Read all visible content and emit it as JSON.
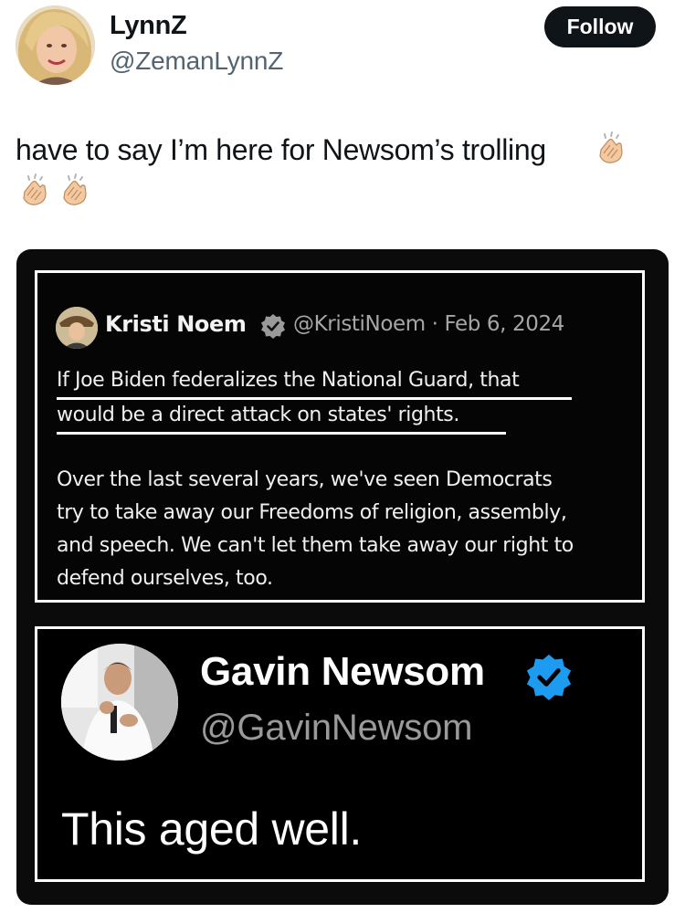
{
  "user": {
    "display_name": "LynnZ",
    "handle": "@ZemanLynnZ",
    "avatar_icon": "profile-photo"
  },
  "follow_button": {
    "label": "Follow"
  },
  "tweet": {
    "text": "have to say I’m here for Newsom’s trolling",
    "emoji": [
      "clapping-hands-icon",
      "clapping-hands-icon",
      "clapping-hands-icon"
    ]
  },
  "media": {
    "quoted_tweet": {
      "name": "Kristi Noem",
      "handle": "@KristiNoem",
      "date": "Feb 6, 2024",
      "meta": "@KristiNoem · Feb 6, 2024",
      "verified": true,
      "paragraph1": [
        "If Joe Biden federalizes the National Guard, that",
        "would be a direct attack on states' rights."
      ],
      "paragraph2": [
        "Over the last several years, we've seen Democrats",
        "try to take away our Freedoms of religion, assembly,",
        "and speech. We can't let them take away our right to",
        "defend ourselves, too."
      ]
    },
    "reply_card": {
      "name": "Gavin Newsom",
      "handle": "@GavinNewsom",
      "verified": true,
      "text": "This aged well."
    }
  },
  "colors": {
    "follow_bg": "#0f1419",
    "verified_blue": "#1d9bf0",
    "handle_gray": "#536471"
  }
}
